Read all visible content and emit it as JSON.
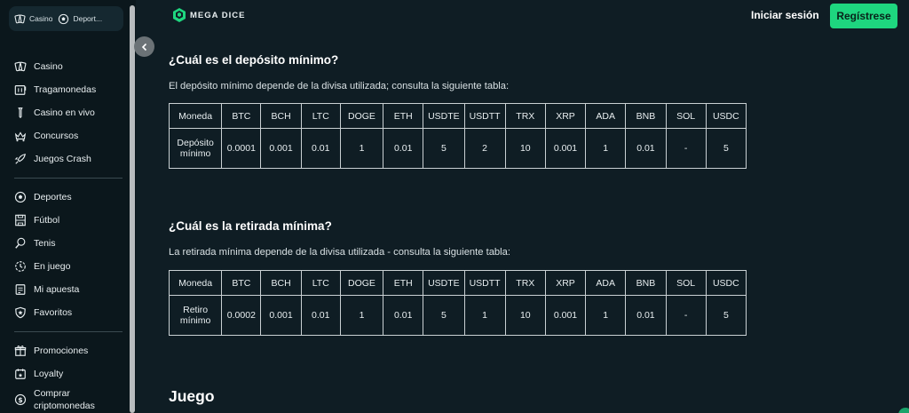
{
  "sidebar": {
    "top_tabs": [
      {
        "label": "Casino",
        "icon": "cards-icon"
      },
      {
        "label": "Deport...",
        "icon": "soccer-ball-icon"
      }
    ],
    "group1": [
      {
        "label": "Casino",
        "icon": "cards-icon"
      },
      {
        "label": "Tragamonedas",
        "icon": "slot-machine-icon"
      },
      {
        "label": "Casino en vivo",
        "icon": "live-casino-icon"
      },
      {
        "label": "Concursos",
        "icon": "trophy-crown-icon"
      },
      {
        "label": "Juegos Crash",
        "icon": "rocket-icon"
      }
    ],
    "group2": [
      {
        "label": "Deportes",
        "icon": "soccer-ball-icon"
      },
      {
        "label": "Fútbol",
        "icon": "soccer-field-icon"
      },
      {
        "label": "Tenis",
        "icon": "tennis-racket-icon"
      },
      {
        "label": "En juego",
        "icon": "live-clock-icon"
      },
      {
        "label": "Mi apuesta",
        "icon": "bet-slip-icon"
      },
      {
        "label": "Favoritos",
        "icon": "star-shield-icon"
      }
    ],
    "group3": [
      {
        "label": "Promociones",
        "icon": "gift-icon"
      },
      {
        "label": "Loyalty",
        "icon": "loyalty-icon"
      },
      {
        "label": "Comprar criptomonedas",
        "icon": "dollar-coin-icon"
      }
    ]
  },
  "header": {
    "logo_text": "MEGA DICE",
    "login_label": "Iniciar sesión",
    "register_label": "Regístrese"
  },
  "colors": {
    "background": "#0f1d24",
    "sidebar": "#0b171c",
    "accent": "#1ed67f"
  },
  "deposit": {
    "title": "¿Cuál es el depósito mínimo?",
    "text": "El depósito mínimo depende de la divisa utilizada; consulta la siguiente tabla:",
    "headers": [
      "Moneda",
      "BTC",
      "BCH",
      "LTC",
      "DOGE",
      "ETH",
      "USDTE",
      "USDTT",
      "TRX",
      "XRP",
      "ADA",
      "BNB",
      "SOL",
      "USDC"
    ],
    "row_label": "Depósito mínimo",
    "values": [
      "0.0001",
      "0.001",
      "0.01",
      "1",
      "0.01",
      "5",
      "2",
      "10",
      "0.001",
      "1",
      "0.01",
      "-",
      "5"
    ]
  },
  "withdrawal": {
    "title": "¿Cuál es la retirada mínima?",
    "text": "La retirada mínima depende de la divisa utilizada - consulta la siguiente tabla:",
    "headers": [
      "Moneda",
      "BTC",
      "BCH",
      "LTC",
      "DOGE",
      "ETH",
      "USDTE",
      "USDTT",
      "TRX",
      "XRP",
      "ADA",
      "BNB",
      "SOL",
      "USDC"
    ],
    "row_label": "Retiro mínimo",
    "values": [
      "0.0002",
      "0.001",
      "0.01",
      "1",
      "0.01",
      "5",
      "1",
      "10",
      "0.001",
      "1",
      "0.01",
      "-",
      "5"
    ]
  },
  "game_section": {
    "title": "Juego"
  }
}
